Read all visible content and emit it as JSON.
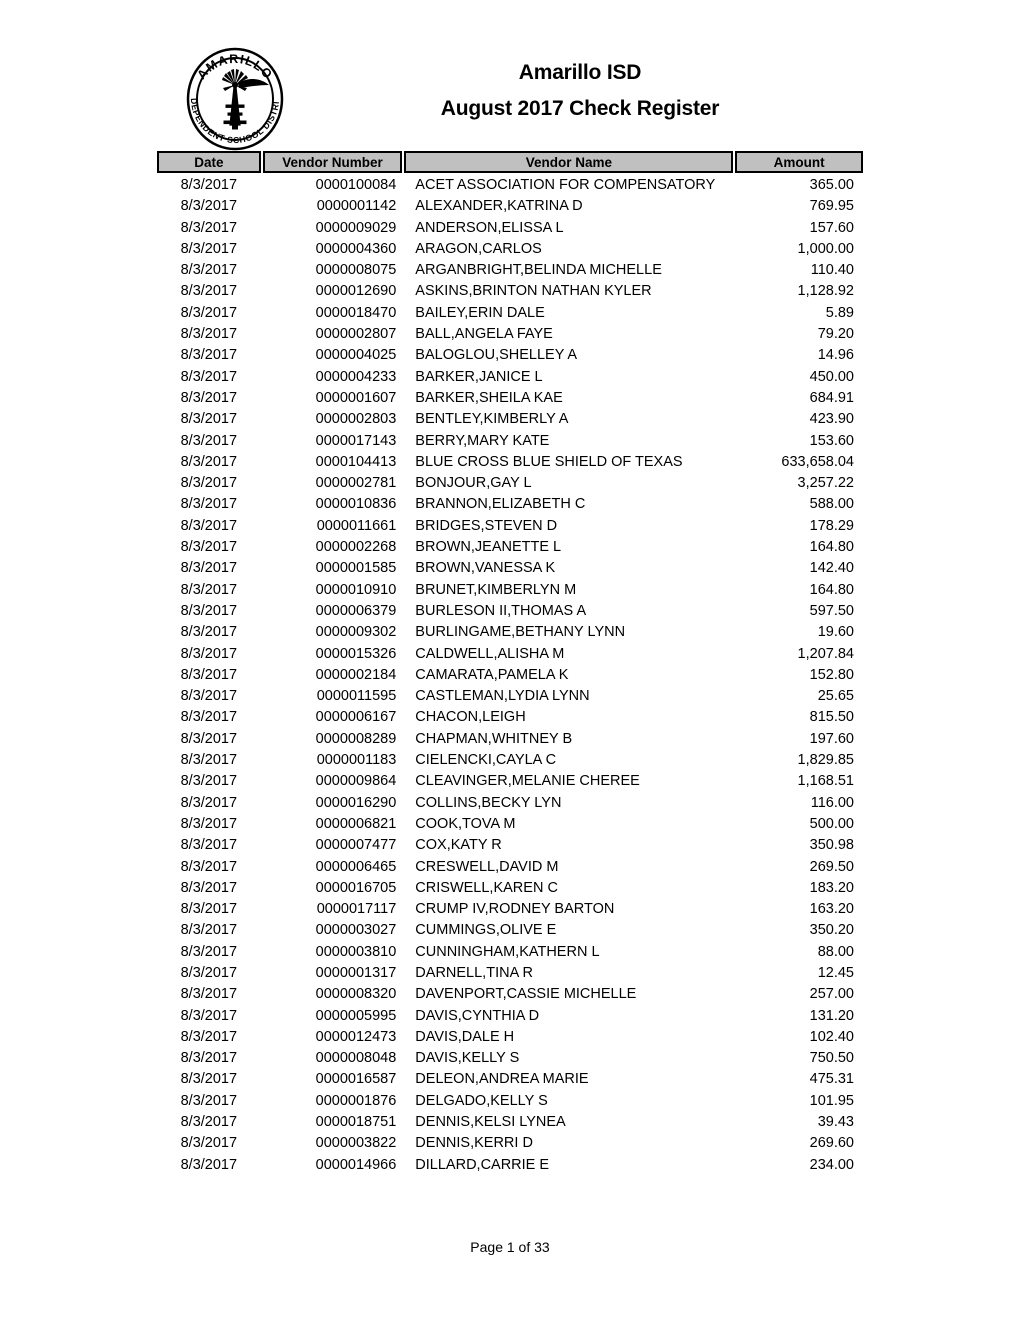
{
  "document": {
    "org_name": "Amarillo ISD",
    "report_title": "August 2017 Check Register",
    "logo": {
      "name": "amarillo-isd-seal",
      "top_arc_text": "AMARILLO",
      "bottom_arc_text": "INDEPENDENT SCHOOL DISTRICT"
    },
    "footer": {
      "page_label": "Page 1 of 33"
    }
  },
  "table": {
    "columns": [
      {
        "key": "date",
        "label": "Date"
      },
      {
        "key": "vendor",
        "label": "Vendor Number"
      },
      {
        "key": "name",
        "label": "Vendor Name"
      },
      {
        "key": "amount",
        "label": "Amount"
      }
    ],
    "header_background": "#c0c0c0",
    "rows": [
      {
        "date": "8/3/2017",
        "vendor": "0000100084",
        "name": "ACET ASSOCIATION FOR COMPENSATORY",
        "amount": "365.00"
      },
      {
        "date": "8/3/2017",
        "vendor": "0000001142",
        "name": "ALEXANDER,KATRINA D",
        "amount": "769.95"
      },
      {
        "date": "8/3/2017",
        "vendor": "0000009029",
        "name": "ANDERSON,ELISSA L",
        "amount": "157.60"
      },
      {
        "date": "8/3/2017",
        "vendor": "0000004360",
        "name": "ARAGON,CARLOS",
        "amount": "1,000.00"
      },
      {
        "date": "8/3/2017",
        "vendor": "0000008075",
        "name": "ARGANBRIGHT,BELINDA MICHELLE",
        "amount": "110.40"
      },
      {
        "date": "8/3/2017",
        "vendor": "0000012690",
        "name": "ASKINS,BRINTON NATHAN KYLER",
        "amount": "1,128.92"
      },
      {
        "date": "8/3/2017",
        "vendor": "0000018470",
        "name": "BAILEY,ERIN DALE",
        "amount": "5.89"
      },
      {
        "date": "8/3/2017",
        "vendor": "0000002807",
        "name": "BALL,ANGELA FAYE",
        "amount": "79.20"
      },
      {
        "date": "8/3/2017",
        "vendor": "0000004025",
        "name": "BALOGLOU,SHELLEY A",
        "amount": "14.96"
      },
      {
        "date": "8/3/2017",
        "vendor": "0000004233",
        "name": "BARKER,JANICE L",
        "amount": "450.00"
      },
      {
        "date": "8/3/2017",
        "vendor": "0000001607",
        "name": "BARKER,SHEILA KAE",
        "amount": "684.91"
      },
      {
        "date": "8/3/2017",
        "vendor": "0000002803",
        "name": "BENTLEY,KIMBERLY A",
        "amount": "423.90"
      },
      {
        "date": "8/3/2017",
        "vendor": "0000017143",
        "name": "BERRY,MARY KATE",
        "amount": "153.60"
      },
      {
        "date": "8/3/2017",
        "vendor": "0000104413",
        "name": "BLUE CROSS BLUE SHIELD OF TEXAS",
        "amount": "633,658.04"
      },
      {
        "date": "8/3/2017",
        "vendor": "0000002781",
        "name": "BONJOUR,GAY L",
        "amount": "3,257.22"
      },
      {
        "date": "8/3/2017",
        "vendor": "0000010836",
        "name": "BRANNON,ELIZABETH C",
        "amount": "588.00"
      },
      {
        "date": "8/3/2017",
        "vendor": "0000011661",
        "name": "BRIDGES,STEVEN D",
        "amount": "178.29"
      },
      {
        "date": "8/3/2017",
        "vendor": "0000002268",
        "name": "BROWN,JEANETTE L",
        "amount": "164.80"
      },
      {
        "date": "8/3/2017",
        "vendor": "0000001585",
        "name": "BROWN,VANESSA K",
        "amount": "142.40"
      },
      {
        "date": "8/3/2017",
        "vendor": "0000010910",
        "name": "BRUNET,KIMBERLYN M",
        "amount": "164.80"
      },
      {
        "date": "8/3/2017",
        "vendor": "0000006379",
        "name": "BURLESON II,THOMAS A",
        "amount": "597.50"
      },
      {
        "date": "8/3/2017",
        "vendor": "0000009302",
        "name": "BURLINGAME,BETHANY LYNN",
        "amount": "19.60"
      },
      {
        "date": "8/3/2017",
        "vendor": "0000015326",
        "name": "CALDWELL,ALISHA M",
        "amount": "1,207.84"
      },
      {
        "date": "8/3/2017",
        "vendor": "0000002184",
        "name": "CAMARATA,PAMELA K",
        "amount": "152.80"
      },
      {
        "date": "8/3/2017",
        "vendor": "0000011595",
        "name": "CASTLEMAN,LYDIA LYNN",
        "amount": "25.65"
      },
      {
        "date": "8/3/2017",
        "vendor": "0000006167",
        "name": "CHACON,LEIGH",
        "amount": "815.50"
      },
      {
        "date": "8/3/2017",
        "vendor": "0000008289",
        "name": "CHAPMAN,WHITNEY B",
        "amount": "197.60"
      },
      {
        "date": "8/3/2017",
        "vendor": "0000001183",
        "name": "CIELENCKI,CAYLA C",
        "amount": "1,829.85"
      },
      {
        "date": "8/3/2017",
        "vendor": "0000009864",
        "name": "CLEAVINGER,MELANIE CHEREE",
        "amount": "1,168.51"
      },
      {
        "date": "8/3/2017",
        "vendor": "0000016290",
        "name": "COLLINS,BECKY LYN",
        "amount": "116.00"
      },
      {
        "date": "8/3/2017",
        "vendor": "0000006821",
        "name": "COOK,TOVA M",
        "amount": "500.00"
      },
      {
        "date": "8/3/2017",
        "vendor": "0000007477",
        "name": "COX,KATY R",
        "amount": "350.98"
      },
      {
        "date": "8/3/2017",
        "vendor": "0000006465",
        "name": "CRESWELL,DAVID M",
        "amount": "269.50"
      },
      {
        "date": "8/3/2017",
        "vendor": "0000016705",
        "name": "CRISWELL,KAREN C",
        "amount": "183.20"
      },
      {
        "date": "8/3/2017",
        "vendor": "0000017117",
        "name": "CRUMP IV,RODNEY BARTON",
        "amount": "163.20"
      },
      {
        "date": "8/3/2017",
        "vendor": "0000003027",
        "name": "CUMMINGS,OLIVE E",
        "amount": "350.20"
      },
      {
        "date": "8/3/2017",
        "vendor": "0000003810",
        "name": "CUNNINGHAM,KATHERN L",
        "amount": "88.00"
      },
      {
        "date": "8/3/2017",
        "vendor": "0000001317",
        "name": "DARNELL,TINA R",
        "amount": "12.45"
      },
      {
        "date": "8/3/2017",
        "vendor": "0000008320",
        "name": "DAVENPORT,CASSIE MICHELLE",
        "amount": "257.00"
      },
      {
        "date": "8/3/2017",
        "vendor": "0000005995",
        "name": "DAVIS,CYNTHIA D",
        "amount": "131.20"
      },
      {
        "date": "8/3/2017",
        "vendor": "0000012473",
        "name": "DAVIS,DALE H",
        "amount": "102.40"
      },
      {
        "date": "8/3/2017",
        "vendor": "0000008048",
        "name": "DAVIS,KELLY S",
        "amount": "750.50"
      },
      {
        "date": "8/3/2017",
        "vendor": "0000016587",
        "name": "DELEON,ANDREA MARIE",
        "amount": "475.31"
      },
      {
        "date": "8/3/2017",
        "vendor": "0000001876",
        "name": "DELGADO,KELLY S",
        "amount": "101.95"
      },
      {
        "date": "8/3/2017",
        "vendor": "0000018751",
        "name": "DENNIS,KELSI LYNEA",
        "amount": "39.43"
      },
      {
        "date": "8/3/2017",
        "vendor": "0000003822",
        "name": "DENNIS,KERRI D",
        "amount": "269.60"
      },
      {
        "date": "8/3/2017",
        "vendor": "0000014966",
        "name": "DILLARD,CARRIE E",
        "amount": "234.00"
      }
    ]
  }
}
